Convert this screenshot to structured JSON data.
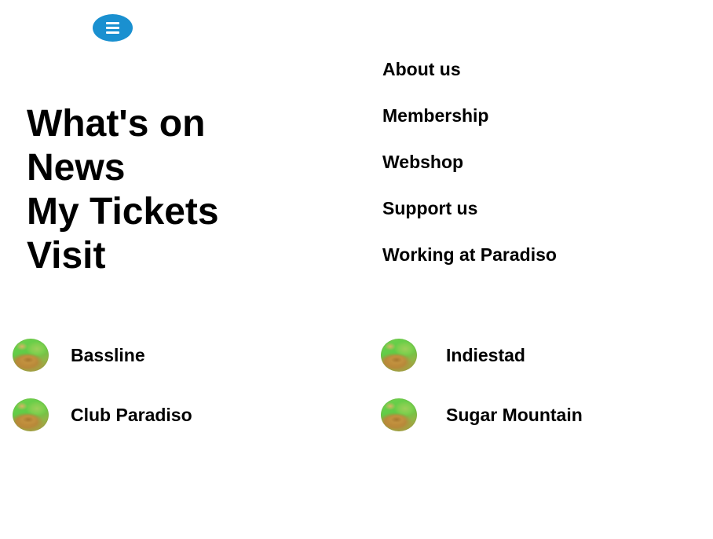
{
  "menu": {
    "icon": "hamburger-menu-icon",
    "color": "#1a90d0"
  },
  "primary_nav": [
    {
      "label": "What's on"
    },
    {
      "label": "News"
    },
    {
      "label": "My Tickets"
    },
    {
      "label": "Visit"
    }
  ],
  "secondary_nav": [
    {
      "label": "About us"
    },
    {
      "label": "Membership"
    },
    {
      "label": "Webshop"
    },
    {
      "label": "Support us"
    },
    {
      "label": "Working at Paradiso"
    }
  ],
  "programmes": [
    {
      "label": "Bassline",
      "icon": "programme-thumbnail"
    },
    {
      "label": "Indiestad",
      "icon": "programme-thumbnail"
    },
    {
      "label": "Club Paradiso",
      "icon": "programme-thumbnail"
    },
    {
      "label": "Sugar Mountain",
      "icon": "programme-thumbnail"
    }
  ]
}
